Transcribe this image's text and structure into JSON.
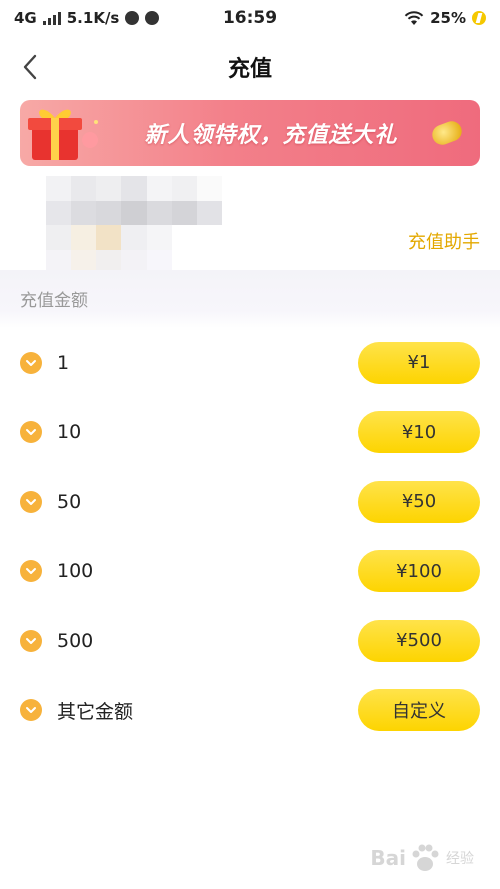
{
  "status_bar": {
    "network": "4G",
    "speed": "5.1K/s",
    "time": "16:59",
    "battery": "25%"
  },
  "nav": {
    "title": "充值",
    "back_icon": "chevron-left-icon"
  },
  "banner": {
    "text": "新人领特权，充值送大礼"
  },
  "account": {
    "assistant_link": "充值助手",
    "section_label": "充值金额"
  },
  "amounts": [
    {
      "label": "1",
      "price": "¥1"
    },
    {
      "label": "10",
      "price": "¥10"
    },
    {
      "label": "50",
      "price": "¥50"
    },
    {
      "label": "100",
      "price": "¥100"
    },
    {
      "label": "500",
      "price": "¥500"
    },
    {
      "label": "其它金额",
      "price": "自定义"
    }
  ],
  "watermark": {
    "text": "Bai",
    "sub": "经验"
  },
  "colors": {
    "accent_yellow": "#fdd400",
    "coin_orange": "#f7b23b",
    "link_gold": "#e3a800",
    "banner_pink": "#ef6b7d"
  }
}
